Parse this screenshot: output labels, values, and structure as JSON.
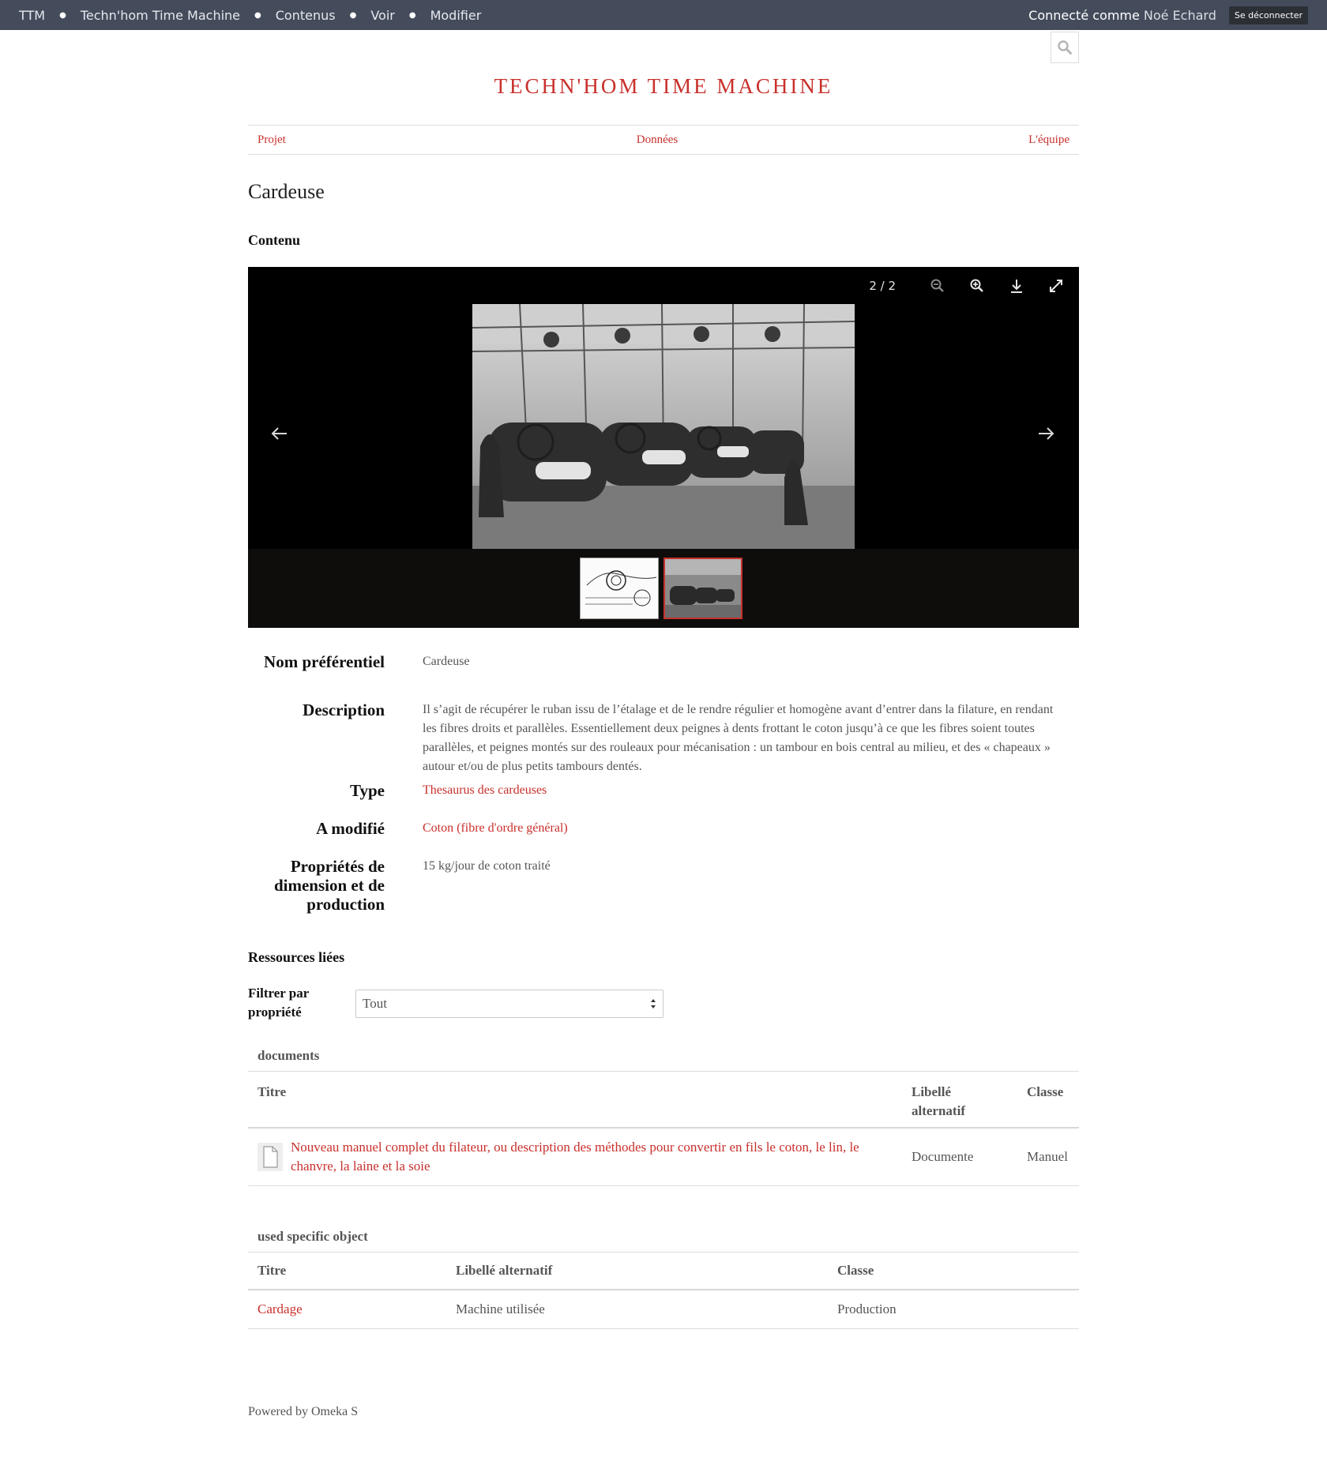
{
  "adminbar": {
    "links": [
      "TTM",
      "Techn'hom Time Machine",
      "Contenus",
      "Voir",
      "Modifier"
    ],
    "connected_prefix": "Connecté comme",
    "user": "Noé Echard",
    "logout": "Se déconnecter"
  },
  "site": {
    "title": "TECHN'HOM TIME MACHINE",
    "nav": [
      "Projet",
      "Données",
      "L'équipe"
    ]
  },
  "page": {
    "title": "Cardeuse",
    "content_heading": "Contenu"
  },
  "viewer": {
    "counter": "2 / 2",
    "tools": [
      "zoom-out-icon",
      "zoom-in-icon",
      "download-icon",
      "fullscreen-icon"
    ]
  },
  "properties": [
    {
      "label": "Nom préférentiel",
      "value": "Cardeuse",
      "link": false
    },
    {
      "label": "Description",
      "value": "Il s’agit de récupérer le ruban issu de l’étalage et de le rendre régulier et homogène avant d’entrer dans la filature, en rendant les fibres droits et parallèles. Essentiellement deux peignes à dents frottant le coton jusqu’à ce que les fibres soient toutes parallèles, et peignes montés sur des rouleaux pour mécanisation : un tambour en bois central au milieu, et des « chapeaux » autour et/ou de plus petits tambours dentés.",
      "link": false
    },
    {
      "label": "Type",
      "value": "Thesaurus des cardeuses",
      "link": true
    },
    {
      "label": "A modifié",
      "value": "Coton (fibre d'ordre général)",
      "link": true
    },
    {
      "label": "Propriétés de dimension et de production",
      "value": "15 kg/jour de coton traité",
      "link": false
    }
  ],
  "linked": {
    "heading": "Ressources liées",
    "filter_label": "Filtrer par propriété",
    "filter_value": "Tout",
    "tables": [
      {
        "caption": "documents",
        "headers": [
          "Titre",
          "Libellé alternatif",
          "Classe"
        ],
        "rows": [
          [
            "Nouveau manuel complet du filateur, ou description des méthodes pour convertir en fils le coton, le lin, le chanvre, la laine et la soie",
            "Documente",
            "Manuel"
          ]
        ]
      },
      {
        "caption": "used specific object",
        "headers": [
          "Titre",
          "Libellé alternatif",
          "Classe"
        ],
        "rows": [
          [
            "Cardage",
            "Machine utilisée",
            "Production"
          ]
        ]
      }
    ]
  },
  "footer": "Powered by Omeka S",
  "colors": {
    "accent": "#c8302c",
    "adminbar": "#444c5c",
    "viewer_bg": "#000000"
  }
}
